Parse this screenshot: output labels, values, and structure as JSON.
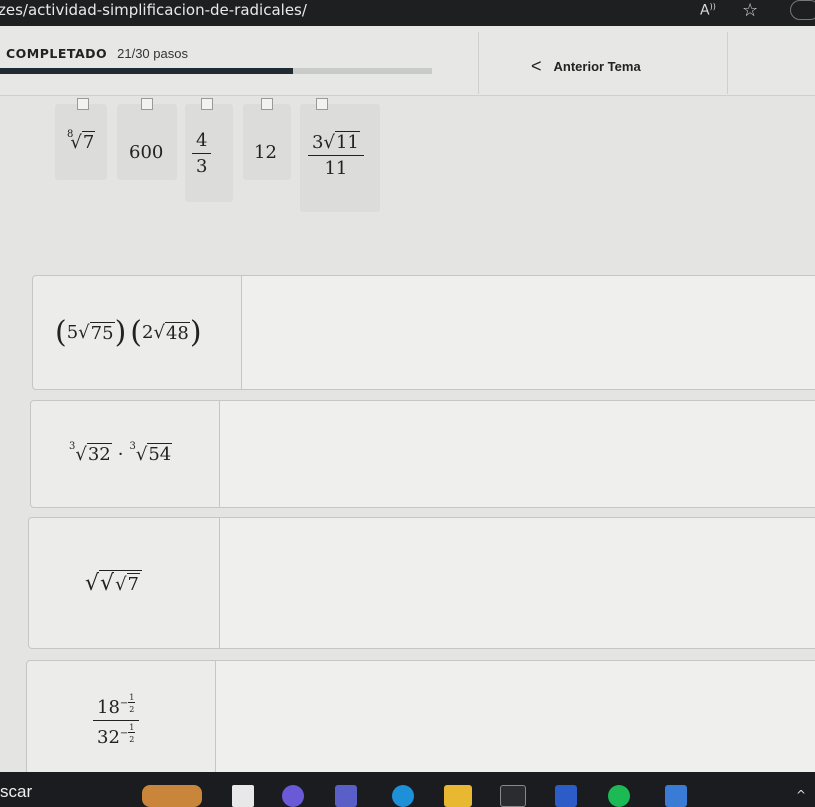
{
  "browser": {
    "url": "zes/actividad-simplificacion-de-radicales/",
    "read_aloud": "A",
    "favorite_icon": "star-icon"
  },
  "progress": {
    "completed_label": "COMPLETADO",
    "steps_text": "21/30 pasos",
    "completed": 21,
    "total": 30
  },
  "nav": {
    "previous_label": "Anterior Tema",
    "chevron_icon": "chevron-left-icon"
  },
  "answers": [
    {
      "id": "a1",
      "root_index": "8",
      "radicand": "7"
    },
    {
      "id": "a2",
      "value": "600"
    },
    {
      "id": "a3",
      "numerator": "4",
      "denominator": "3"
    },
    {
      "id": "a4",
      "value": "12"
    },
    {
      "id": "a5",
      "coef": "3",
      "radicand": "11",
      "denominator": "11"
    }
  ],
  "questions": [
    {
      "id": "q1",
      "coef1": "5",
      "radicand1": "75",
      "coef2": "2",
      "radicand2": "48"
    },
    {
      "id": "q2",
      "index1": "3",
      "radicand1": "32",
      "operator": "·",
      "index2": "3",
      "radicand2": "54"
    },
    {
      "id": "q3",
      "radicand": "7"
    },
    {
      "id": "q4",
      "base_num": "18",
      "exp_num_sign": "−",
      "exp_num_n": "1",
      "exp_num_d": "2",
      "base_den": "32",
      "exp_den_sign": "−",
      "exp_den_n": "1",
      "exp_den_d": "2"
    }
  ],
  "taskbar": {
    "search_label": "scar",
    "colors": {
      "bg": "#1a1c1f",
      "accent": "#2b5cc8"
    }
  }
}
